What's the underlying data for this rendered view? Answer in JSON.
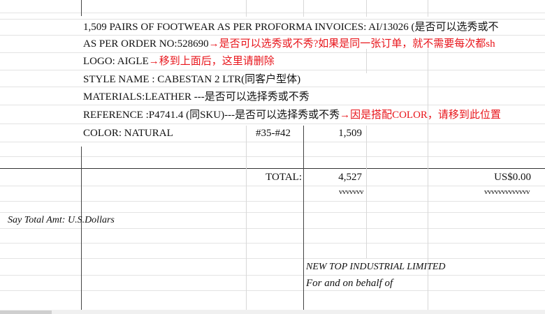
{
  "rows": {
    "line1": {
      "text": "1,509 PAIRS OF FOOTWEAR AS PER PROFORMA INVOICES: AI/13026 (是否可以选秀或不"
    },
    "line2": {
      "text": "AS PER ORDER NO:528690",
      "note": "→是否可以选秀或不秀?如果是同一张订单，就不需要每次都sh"
    },
    "line3": {
      "text": "LOGO: AIGLE",
      "note": "→移到上面后，这里请删除"
    },
    "line4": {
      "text": "STYLE NAME : CABESTAN 2 LTR(同客户型体)"
    },
    "line5": {
      "text": "MATERIALS:LEATHER ---是否可以选择秀或不秀"
    },
    "line6": {
      "text": "REFERENCE :P4741.4 (同SKU)---是否可以选择秀或不秀",
      "note": "→因是搭配COLOR，请移到此位置"
    },
    "line7": {
      "text": "COLOR: NATURAL",
      "size": "#35-#42",
      "qty": "1,509"
    }
  },
  "totals": {
    "label": "TOTAL:",
    "qty": "4,527",
    "amount": "US$0.00",
    "qty_mark": "vvvvvvv",
    "amount_mark": "vvvvvvvvvvvvv"
  },
  "say_total": "Say Total Amt: U.S.Dollars",
  "signature": {
    "company": "NEW TOP INDUSTRIAL LIMITED",
    "behalf": "For  and  on  behalf of"
  }
}
